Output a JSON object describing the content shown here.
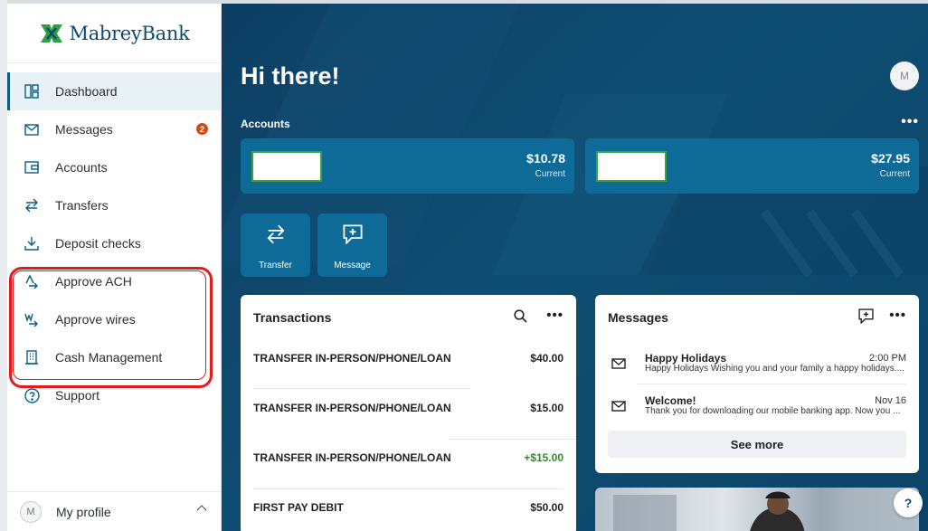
{
  "brand": {
    "name": "MabreyBank"
  },
  "sidebar": {
    "items": [
      {
        "label": "Dashboard",
        "icon": "dashboard-icon",
        "active": true
      },
      {
        "label": "Messages",
        "icon": "envelope-icon",
        "badge": "2"
      },
      {
        "label": "Accounts",
        "icon": "wallet-icon"
      },
      {
        "label": "Transfers",
        "icon": "transfer-arrows-icon"
      },
      {
        "label": "Deposit checks",
        "icon": "deposit-icon"
      },
      {
        "label": "Approve ACH",
        "icon": "approve-ach-icon"
      },
      {
        "label": "Approve wires",
        "icon": "approve-wires-icon"
      },
      {
        "label": "Cash Management",
        "icon": "building-icon"
      },
      {
        "label": "Support",
        "icon": "help-circle-icon"
      }
    ],
    "profile": {
      "initial": "M",
      "label": "My profile"
    }
  },
  "header": {
    "greeting": "Hi there!",
    "avatar_initial": "M"
  },
  "accounts": {
    "label": "Accounts",
    "more": "•••",
    "items": [
      {
        "amount": "$10.78",
        "sub": "Current"
      },
      {
        "amount": "$27.95",
        "sub": "Current"
      }
    ]
  },
  "quick_actions": [
    {
      "label": "Transfer",
      "icon": "transfer-arrows-icon"
    },
    {
      "label": "Message",
      "icon": "new-message-icon"
    }
  ],
  "transactions": {
    "title": "Transactions",
    "more": "•••",
    "rows": [
      {
        "description": "TRANSFER IN-PERSON/PHONE/LOAN",
        "amount": "$40.00"
      },
      {
        "description": "TRANSFER IN-PERSON/PHONE/LOAN",
        "amount": "$15.00"
      },
      {
        "description": "TRANSFER IN-PERSON/PHONE/LOAN",
        "amount": "+$15.00"
      },
      {
        "description": "FIRST PAY DEBIT",
        "amount": "$50.00"
      }
    ]
  },
  "messages": {
    "title": "Messages",
    "more": "•••",
    "rows": [
      {
        "title": "Happy Holidays",
        "preview": "Happy Holidays Wishing you and your family a happy holidays....",
        "time": "2:00 PM"
      },
      {
        "title": "Welcome!",
        "preview": "Thank you for downloading our mobile banking app. Now you ...",
        "time": "Nov 16"
      }
    ],
    "see_more": "See more"
  },
  "help": {
    "label": "?"
  },
  "colors": {
    "primary": "#0b5d86",
    "tile": "#0e6b98",
    "positive": "#2e8b2e",
    "highlight": "#e31b1b"
  }
}
